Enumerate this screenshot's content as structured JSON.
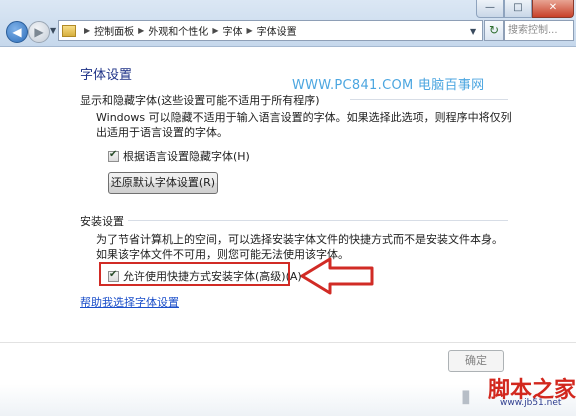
{
  "window": {
    "minimize_glyph": "—",
    "maximize_glyph": "□",
    "close_glyph": "✕"
  },
  "address_bar": {
    "breadcrumb": [
      "控制面板",
      "外观和个性化",
      "字体",
      "字体设置"
    ],
    "search_placeholder": "搜索控制..."
  },
  "page": {
    "title": "字体设置",
    "watermark": "WWW.PC841.COM 电脑百事网"
  },
  "section_hide": {
    "heading": "显示和隐藏字体(这些设置可能不适用于所有程序)",
    "description": "Windows 可以隐藏不适用于输入语言设置的字体。如果选择此选项，则程序中将仅列出适用于语言设置的字体。",
    "checkbox_label": "根据语言设置隐藏字体(H)",
    "checkbox_checked": true,
    "restore_button": "还原默认字体设置(R)"
  },
  "section_install": {
    "heading": "安装设置",
    "description": "为了节省计算机上的空间，可以选择安装字体文件的快捷方式而不是安装文件本身。如果该字体文件不可用，则您可能无法使用该字体。",
    "checkbox_label": "允许使用快捷方式安装字体(高级)(A)",
    "checkbox_checked": true
  },
  "help_link": "帮助我选择字体设置",
  "ok_button": "确定",
  "brand": {
    "name": "脚本之家",
    "url": "www.jb51.net"
  },
  "colors": {
    "title": "#1e3287",
    "link": "#1a4ec9",
    "highlight": "#d12b25",
    "watermark": "#4ca6e0"
  }
}
